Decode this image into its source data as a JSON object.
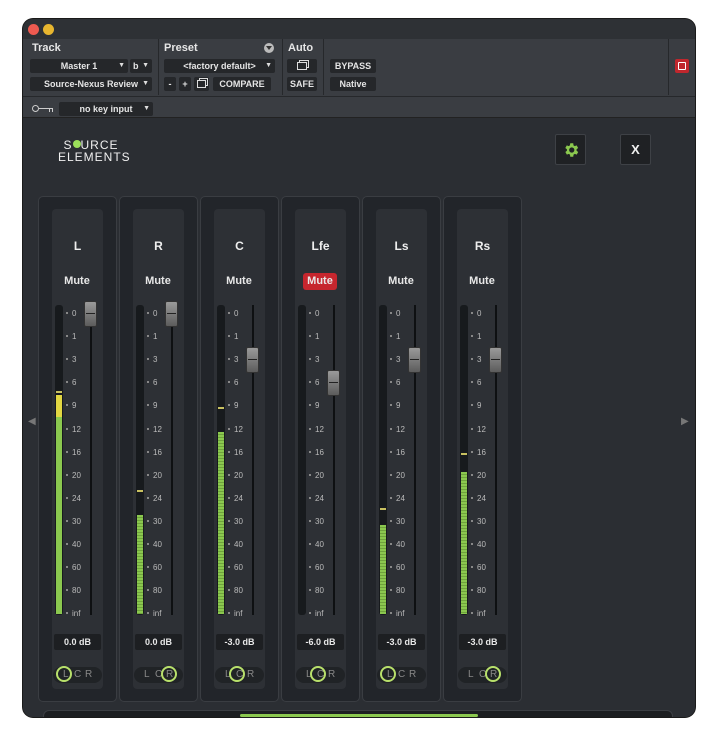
{
  "header": {
    "track_label": "Track",
    "preset_label": "Preset",
    "auto_label": "Auto",
    "track_select": "Master 1",
    "track_variant": "b",
    "insert_select": "Source-Nexus Review",
    "preset_select": "<factory default>",
    "minus": "-",
    "plus": "+",
    "compare": "COMPARE",
    "bypass": "BYPASS",
    "safe": "SAFE",
    "native": "Native",
    "key_input": "no key input"
  },
  "plugin": {
    "logo_line1": "SOURCE",
    "logo_line2": "ELEMENTS",
    "close": "X",
    "mute_label": "Mute",
    "scale": [
      "0",
      "1",
      "3",
      "6",
      "9",
      "12",
      "16",
      "20",
      "24",
      "30",
      "40",
      "60",
      "80",
      "inf"
    ],
    "pan_letters": [
      "L",
      "C",
      "R"
    ],
    "channels": [
      {
        "name": "L",
        "db": "0.0 dB",
        "muted": false,
        "meter": 0.71,
        "hot": true,
        "peak": 0.71,
        "fader_db": 0,
        "pan": "L"
      },
      {
        "name": "R",
        "db": "0.0 dB",
        "muted": false,
        "meter": 0.32,
        "hot": false,
        "peak": 0.39,
        "fader_db": 0,
        "pan": "R"
      },
      {
        "name": "C",
        "db": "-3.0 dB",
        "muted": false,
        "meter": 0.59,
        "hot": false,
        "peak": 0.66,
        "fader_db": -3,
        "pan": "C"
      },
      {
        "name": "Lfe",
        "db": "-6.0 dB",
        "muted": true,
        "meter": 0,
        "hot": false,
        "peak": 0,
        "fader_db": -6,
        "pan": "C"
      },
      {
        "name": "Ls",
        "db": "-3.0 dB",
        "muted": false,
        "meter": 0.29,
        "hot": false,
        "peak": 0.33,
        "fader_db": -3,
        "pan": "L"
      },
      {
        "name": "Rs",
        "db": "-3.0 dB",
        "muted": false,
        "meter": 0.46,
        "hot": false,
        "peak": 0.51,
        "fader_db": -3,
        "pan": "R"
      }
    ]
  },
  "colors": {
    "accent": "#8bc84f",
    "mute_on": "#c6262e",
    "peak": "#c8c060"
  }
}
